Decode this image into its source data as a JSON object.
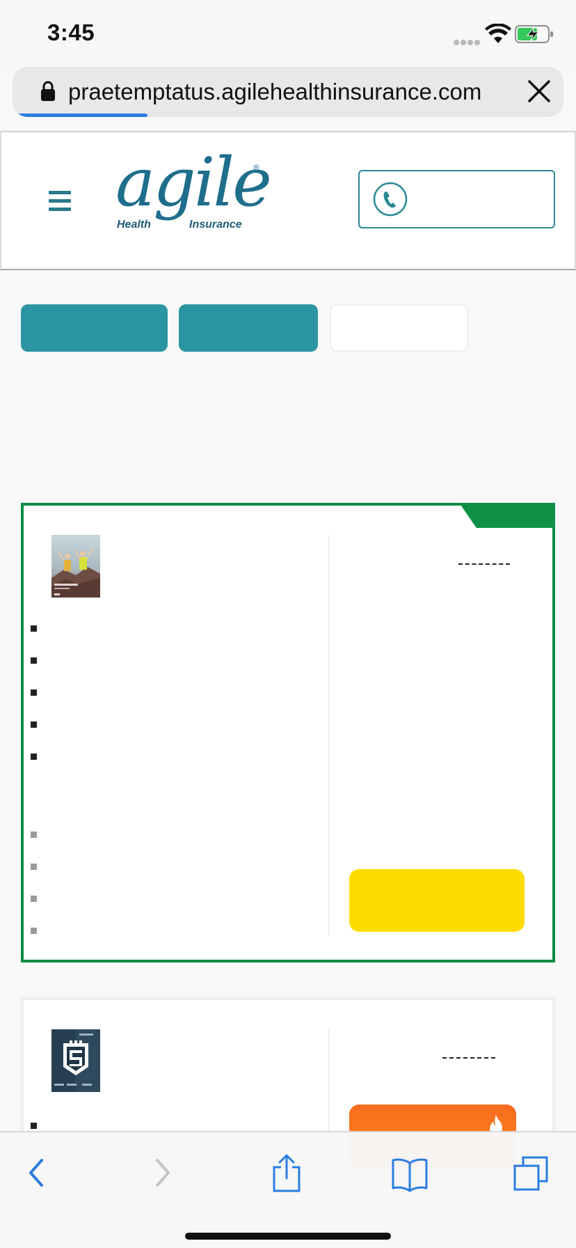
{
  "status_bar": {
    "time": "3:45",
    "signal_icon": "cellular-dots-icon",
    "wifi_icon": "wifi-icon",
    "battery_icon": "battery-charging-icon"
  },
  "browser": {
    "url": "praetemptatus.agilehealthinsurance.com",
    "lock_icon": "lock-icon",
    "close_icon": "close-icon",
    "load_progress": 0.24
  },
  "header": {
    "menu_icon": "hamburger-menu-icon",
    "logo": {
      "word": "agile",
      "registered": "®",
      "line_left": "Health",
      "line_right": "Insurance"
    },
    "call_icon": "phone-icon"
  },
  "colors": {
    "brand_teal": "#2b96a1",
    "logo_blue": "#1f6e8c",
    "featured_border": "#0e8a44",
    "apply_yellow": "#ffdc00",
    "hot_orange": "#f86b1e"
  },
  "toolbar": {
    "back_icon": "chevron-left-icon",
    "forward_icon": "chevron-right-icon",
    "share_icon": "share-icon",
    "bookmarks_icon": "book-icon",
    "tabs_icon": "tabs-icon"
  }
}
